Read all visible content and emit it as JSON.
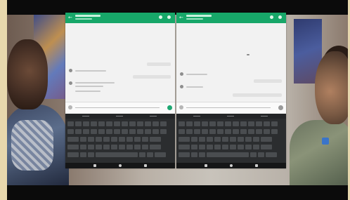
{
  "scene": {
    "description_colors": {
      "frame": "#e7d7ad",
      "letterbox": "#0b0b0b",
      "appbar_accent": "#17a769",
      "keyboard": "#2b2d2f"
    }
  },
  "tablets": [
    {
      "side": "left",
      "app_bar_icons": [
        "back-arrow-icon",
        "search-icon",
        "more-vert-icon"
      ]
    },
    {
      "side": "right",
      "app_bar_icons": [
        "back-arrow-icon",
        "search-icon",
        "more-vert-icon"
      ]
    }
  ]
}
